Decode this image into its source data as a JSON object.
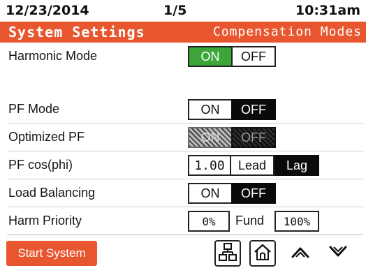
{
  "status": {
    "date": "12/23/2014",
    "page": "1/5",
    "time": "10:31am"
  },
  "header": {
    "title": "System Settings",
    "subtitle": "Compensation Modes"
  },
  "rows": {
    "harmonic_mode": {
      "label": "Harmonic Mode",
      "on": "ON",
      "off": "OFF",
      "selected": "ON"
    },
    "pf_mode": {
      "label": "PF Mode",
      "on": "ON",
      "off": "OFF",
      "selected": "OFF"
    },
    "optimized_pf": {
      "label": "Optimized PF",
      "on": "ON",
      "off": "OFF",
      "state": "disabled"
    },
    "pf_cos_phi": {
      "label": "PF cos(phi)",
      "value": "1.00",
      "lead": "Lead",
      "lag": "Lag",
      "selected": "Lag"
    },
    "load_balancing": {
      "label": "Load Balancing",
      "on": "ON",
      "off": "OFF",
      "selected": "OFF"
    },
    "harm_priority": {
      "label": "Harm Priority",
      "left_value": "0%",
      "middle": "Fund",
      "right_value": "100%"
    }
  },
  "bottom": {
    "start_label": "Start System",
    "icons": [
      "network-icon",
      "home-icon",
      "chevron-up-icon",
      "chevron-down-icon"
    ]
  },
  "colors": {
    "accent": "#e8562f",
    "on_green": "#3ca63b",
    "selected_dark": "#0a0a0a"
  }
}
